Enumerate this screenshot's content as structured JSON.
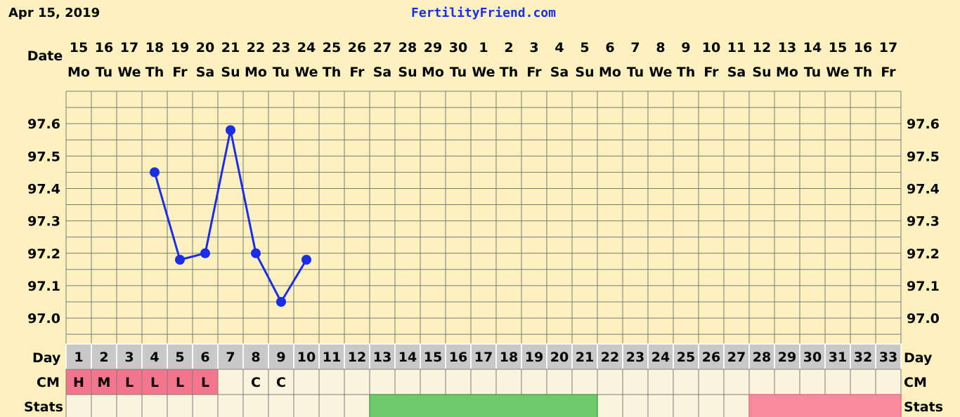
{
  "header": {
    "date": "Apr 15, 2019",
    "brand": "FertilityFriend.com"
  },
  "labels": {
    "date": "Date",
    "day": "Day",
    "cm": "CM",
    "stats": "Stats"
  },
  "colors": {
    "background": "#fdf1c0",
    "grid": "#7a7a7a",
    "line": "#1a2ee8",
    "day_row": "#c8c8c8",
    "cell": "#fdf4e0",
    "menses": "#f4758e",
    "fertile": "#6ecb6b",
    "luteal": "#fa8aa0"
  },
  "chart_data": {
    "type": "line",
    "title": "",
    "ylim": [
      96.92,
      97.7
    ],
    "yticks": [
      "97.6",
      "97.5",
      "97.4",
      "97.3",
      "97.2",
      "97.1",
      "97.0"
    ],
    "dates": [
      "15",
      "16",
      "17",
      "18",
      "19",
      "20",
      "21",
      "22",
      "23",
      "24",
      "25",
      "26",
      "27",
      "28",
      "29",
      "30",
      "1",
      "2",
      "3",
      "4",
      "5",
      "6",
      "7",
      "8",
      "9",
      "10",
      "11",
      "12",
      "13",
      "14",
      "15",
      "16",
      "17"
    ],
    "weekdays": [
      "Mo",
      "Tu",
      "We",
      "Th",
      "Fr",
      "Sa",
      "Su",
      "Mo",
      "Tu",
      "We",
      "Th",
      "Fr",
      "Sa",
      "Su",
      "Mo",
      "Tu",
      "We",
      "Th",
      "Fr",
      "Sa",
      "Su",
      "Mo",
      "Tu",
      "We",
      "Th",
      "Fr",
      "Sa",
      "Su",
      "Mo",
      "Tu",
      "We",
      "Th",
      "Fr"
    ],
    "cycle_days": [
      "1",
      "2",
      "3",
      "4",
      "5",
      "6",
      "7",
      "8",
      "9",
      "10",
      "11",
      "12",
      "13",
      "14",
      "15",
      "16",
      "17",
      "18",
      "19",
      "20",
      "21",
      "22",
      "23",
      "24",
      "25",
      "26",
      "27",
      "28",
      "29",
      "30",
      "31",
      "32",
      "33"
    ],
    "series": [
      {
        "values": [
          null,
          null,
          null,
          97.45,
          97.18,
          97.2,
          97.58,
          97.2,
          97.05,
          97.18,
          null,
          null,
          null,
          null,
          null,
          null,
          null,
          null,
          null,
          null,
          null,
          null,
          null,
          null,
          null,
          null,
          null,
          null,
          null,
          null,
          null,
          null,
          null
        ]
      }
    ],
    "cm": [
      "H",
      "M",
      "L",
      "L",
      "L",
      "L",
      "",
      "C",
      "C",
      "",
      "",
      "",
      "",
      "",
      "",
      "",
      "",
      "",
      "",
      "",
      "",
      "",
      "",
      "",
      "",
      "",
      "",
      "",
      "",
      "",
      "",
      "",
      ""
    ],
    "cm_menses_days": [
      1,
      2,
      3,
      4,
      5,
      6
    ],
    "stats_fertile_days": [
      13,
      14,
      15,
      16,
      17,
      18,
      19,
      20,
      21
    ],
    "stats_luteal_days": [
      28,
      29,
      30,
      31,
      32,
      33
    ]
  }
}
